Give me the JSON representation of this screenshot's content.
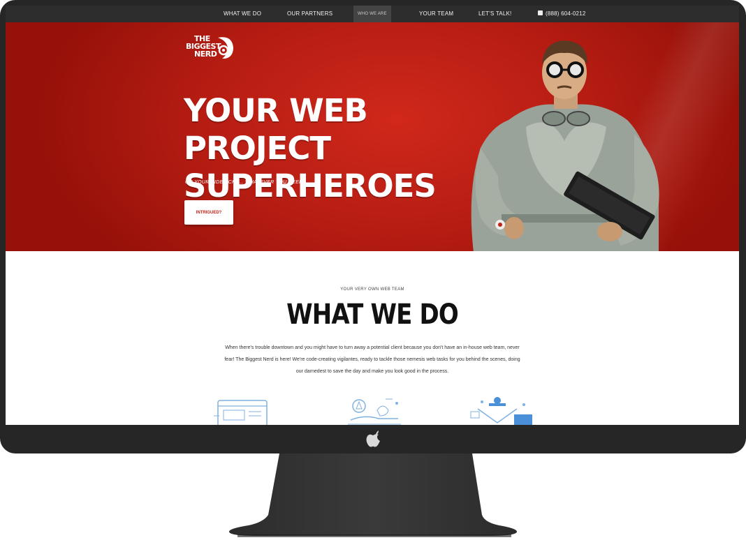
{
  "nav": {
    "items": [
      "WHAT WE DO",
      "OUR PARTNERS",
      "WHO WE ARE",
      "YOUR TEAM",
      "LET'S TALK!"
    ],
    "phone": "(888) 604-0212"
  },
  "hero": {
    "logo_lines": [
      "THE",
      "BIGGEST",
      "NERD"
    ],
    "title": "YOUR WEB PROJECT SUPERHEROES",
    "subtitle": "OR YOUR SIDEKICKS... WHATEVER YOU NEED!",
    "cta": "INTRIGUED?"
  },
  "section": {
    "eyebrow": "YOUR VERY OWN WEB TEAM",
    "title": "WHAT WE DO",
    "body": "When there's trouble downtown and you might have to turn away a potential client because you don't have an in-house web team, never fear! The Biggest Nerd is here! We're code-creating vigilantes, ready to tackle those nemesis web tasks for you behind the scenes, doing our darnedest to save the day and make you look good in the process."
  },
  "colors": {
    "hero_red": "#c1221a",
    "nav_bg": "#2d2d2d",
    "icon_blue": "#4a90d9"
  },
  "icons": [
    "apple-logo-icon",
    "phone-icon",
    "web-design-icon",
    "development-icon",
    "marketing-icon"
  ]
}
